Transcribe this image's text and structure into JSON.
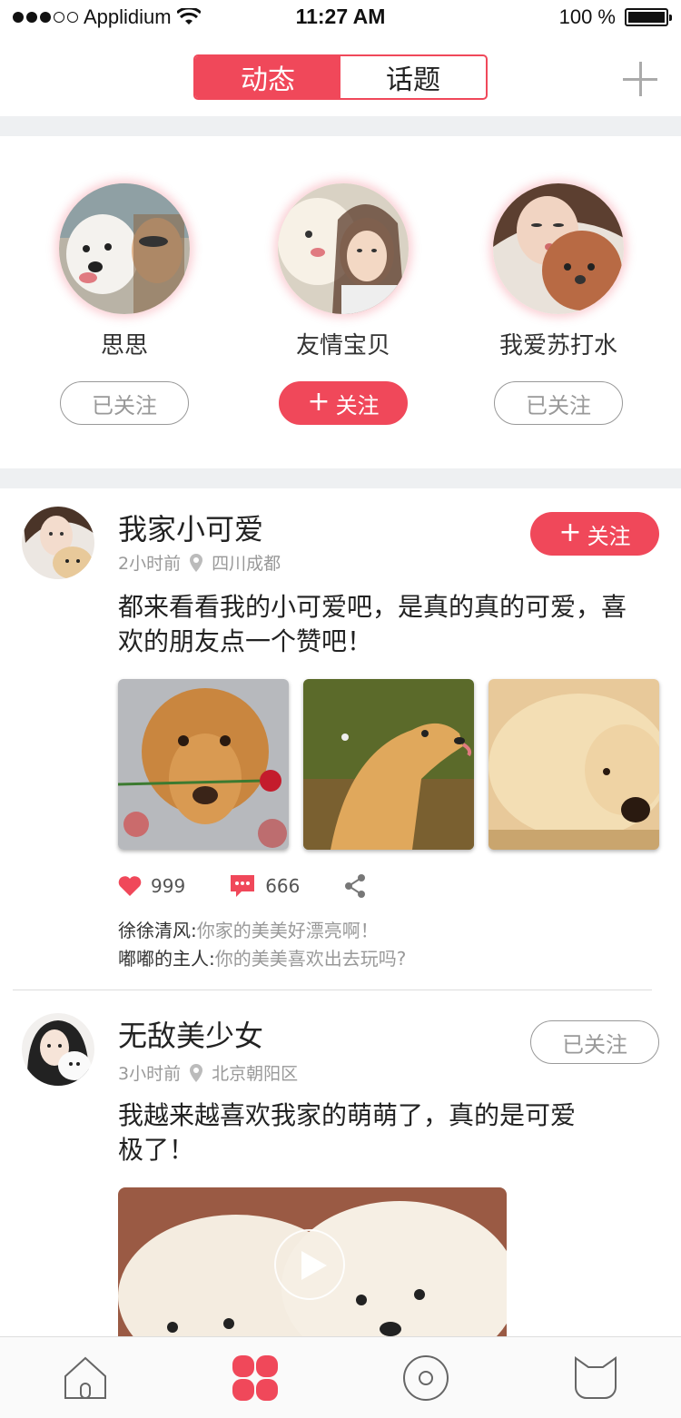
{
  "status_bar": {
    "carrier": "Applidium",
    "time": "11:27 AM",
    "battery": "100 %"
  },
  "nav": {
    "tabs": [
      {
        "label": "动态",
        "active": true
      },
      {
        "label": "话题",
        "active": false
      }
    ],
    "add_icon": "plus-icon"
  },
  "colors": {
    "accent": "#f0485a",
    "muted": "#999999",
    "background": "#eef0f2"
  },
  "recommended": [
    {
      "name": "思思",
      "button": "已关注",
      "following": true
    },
    {
      "name": "友情宝贝",
      "button": "关注",
      "following": false
    },
    {
      "name": "我爱苏打水",
      "button": "已关注",
      "following": true
    }
  ],
  "posts": [
    {
      "user": "我家小可爱",
      "time": "2小时前",
      "location": "四川成都",
      "button": "关注",
      "following": false,
      "text": "都来看看我的小可爱吧，是真的真的可爱，喜欢的朋友点一个赞吧！",
      "likes": "999",
      "comments_count": "666",
      "comments": [
        {
          "user": "徐徐清风:",
          "text": "你家的美美好漂亮啊！"
        },
        {
          "user": "嘟嘟的主人:",
          "text": "你的美美喜欢出去玩吗?"
        }
      ]
    },
    {
      "user": "无敌美少女",
      "time": "3小时前",
      "location": "北京朝阳区",
      "button": "已关注",
      "following": true,
      "text": "我越来越喜欢我家的萌萌了，真的是可爱极了！"
    }
  ],
  "tabbar": [
    "home-icon",
    "clover-icon",
    "disc-icon",
    "cat-icon"
  ]
}
